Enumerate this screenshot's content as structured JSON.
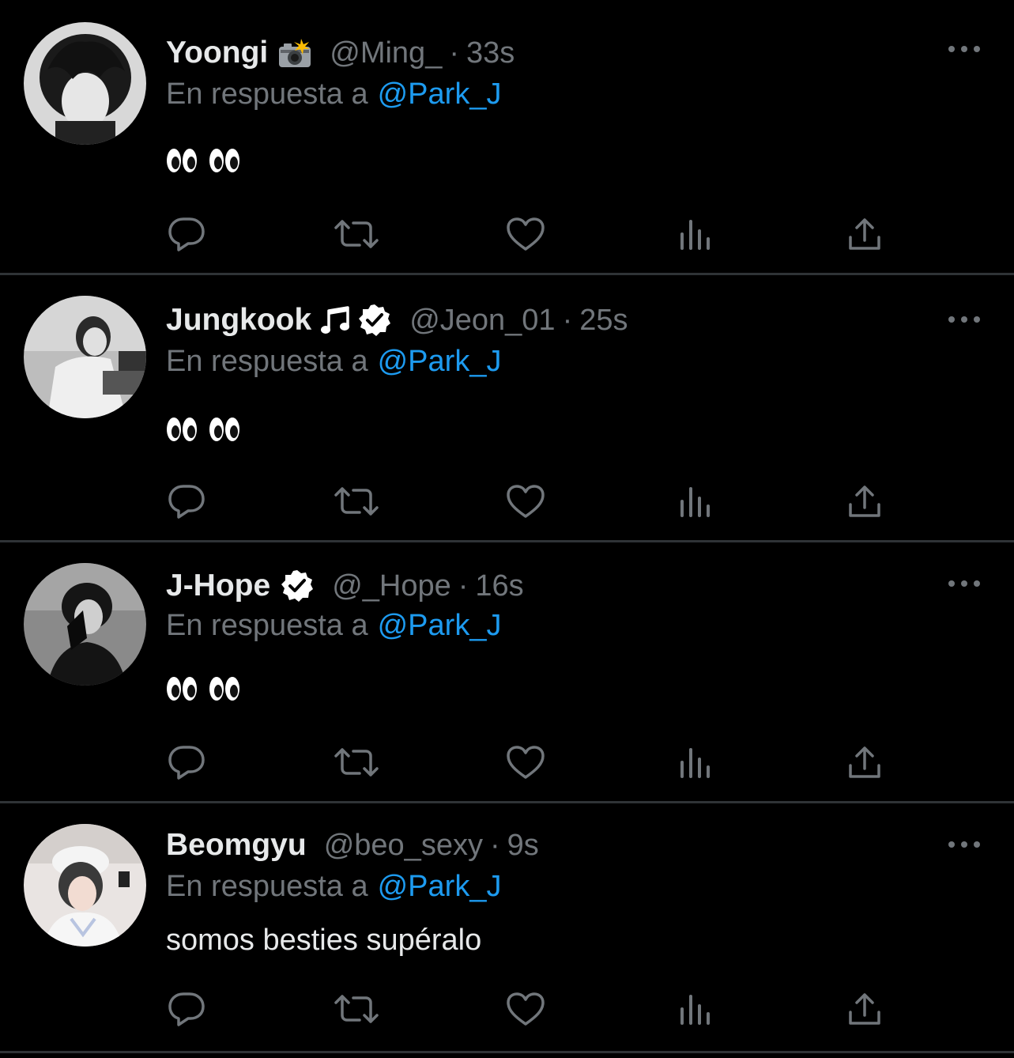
{
  "colors": {
    "background": "#000000",
    "text_primary": "#e7e9ea",
    "text_secondary": "#71767b",
    "accent_mention": "#1d9bf0",
    "divider": "#2f3336"
  },
  "reply_prefix": "En respuesta a",
  "tweets": [
    {
      "name": "Yoongi",
      "name_emoji": "camera-flash-icon",
      "verified": false,
      "handle": "@Ming_",
      "separator": "·",
      "time": "33s",
      "reply_mention": "@Park_J",
      "body_emoji": "eyes eyes",
      "body_text": ""
    },
    {
      "name": "Jungkook",
      "name_emoji": "music-note-icon",
      "verified": true,
      "handle": "@Jeon_01",
      "separator": "·",
      "time": "25s",
      "reply_mention": "@Park_J",
      "body_emoji": "eyes eyes",
      "body_text": ""
    },
    {
      "name": "J-Hope",
      "name_emoji": "",
      "verified": true,
      "handle": "@_Hope",
      "separator": "·",
      "time": "16s",
      "reply_mention": "@Park_J",
      "body_emoji": "eyes eyes",
      "body_text": ""
    },
    {
      "name": "Beomgyu",
      "name_emoji": "",
      "verified": false,
      "handle": "@beo_sexy",
      "separator": "·",
      "time": "9s",
      "reply_mention": "@Park_J",
      "body_emoji": "",
      "body_text": "somos besties supéralo"
    }
  ],
  "action_icons": [
    "reply-icon",
    "retweet-icon",
    "like-icon",
    "views-icon",
    "share-icon"
  ]
}
